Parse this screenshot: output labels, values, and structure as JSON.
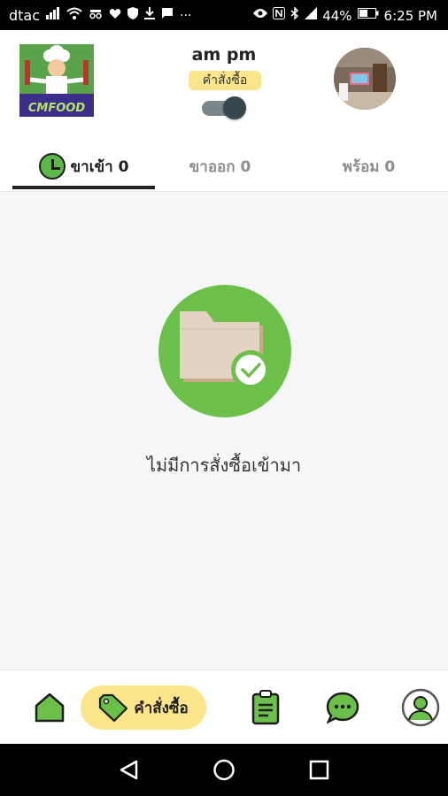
{
  "status_bar": {
    "carrier": "dtac",
    "battery": "44%",
    "time": "6:25 PM",
    "more": "···"
  },
  "header": {
    "logo_text": "CMFOOD",
    "shop_name": "am pm",
    "mode_badge": "คำสั่งซื้อ",
    "toggle_on": true
  },
  "tabs": [
    {
      "label": "ขาเข้า 0",
      "active": true,
      "icon": "clock-icon"
    },
    {
      "label": "ขาออก 0",
      "active": false
    },
    {
      "label": "พร้อม 0",
      "active": false
    }
  ],
  "empty_state": {
    "icon": "folder-check-icon",
    "message": "ไม่มีการสั่งซื้อเข้ามา"
  },
  "bottom_nav": {
    "items": [
      {
        "name": "home",
        "icon": "home-icon"
      },
      {
        "name": "orders",
        "icon": "tag-icon",
        "label": "คำสั่งซื้อ",
        "active": true
      },
      {
        "name": "menu",
        "icon": "clipboard-icon"
      },
      {
        "name": "chat",
        "icon": "chat-icon"
      },
      {
        "name": "profile",
        "icon": "user-icon"
      }
    ]
  },
  "colors": {
    "accent_green": "#6cc04a",
    "badge_yellow": "#fbe58a",
    "dark": "#222222"
  }
}
